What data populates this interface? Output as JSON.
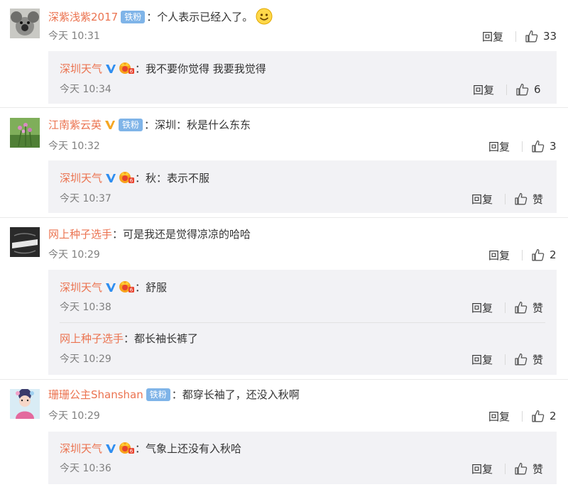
{
  "reply_label": "回复",
  "fan_badge": "铁粉",
  "like_zero_label": "赞",
  "comments": [
    {
      "user": "深紫浅紫2017",
      "text": "：个人表示已经入了。",
      "time": "今天 10:31",
      "likes": "33",
      "replies": [
        {
          "user": "深圳天气",
          "text": "：我不要你觉得  我要我觉得",
          "time": "今天 10:34",
          "likes": "6"
        }
      ]
    },
    {
      "user": "江南紫云英",
      "text": "：深圳：秋是什么东东",
      "time": "今天 10:32",
      "likes": "3",
      "replies": [
        {
          "user": "深圳天气",
          "text": "：秋：表示不服",
          "time": "今天 10:37",
          "likes": "赞"
        }
      ]
    },
    {
      "user": "网上种子选手",
      "text": "：可是我还是觉得凉凉的哈哈",
      "time": "今天 10:29",
      "likes": "2",
      "replies": [
        {
          "user": "深圳天气",
          "text": "：舒服",
          "time": "今天 10:38",
          "likes": "赞"
        },
        {
          "user": "网上种子选手",
          "text": "：都长袖长裤了",
          "time": "今天 10:29",
          "likes": "赞"
        }
      ]
    },
    {
      "user": "珊珊公主Shanshan",
      "text": "：都穿长袖了，还没入秋啊",
      "time": "今天 10:29",
      "likes": "2",
      "replies": [
        {
          "user": "深圳天气",
          "text": "：气象上还没有入秋哈",
          "time": "今天 10:36",
          "likes": "赞"
        }
      ]
    }
  ],
  "colors": {
    "username": "#eb7350",
    "badge": "#7fb4e8",
    "reply_bg": "#f2f2f5",
    "verified": "#2f8ef0"
  }
}
